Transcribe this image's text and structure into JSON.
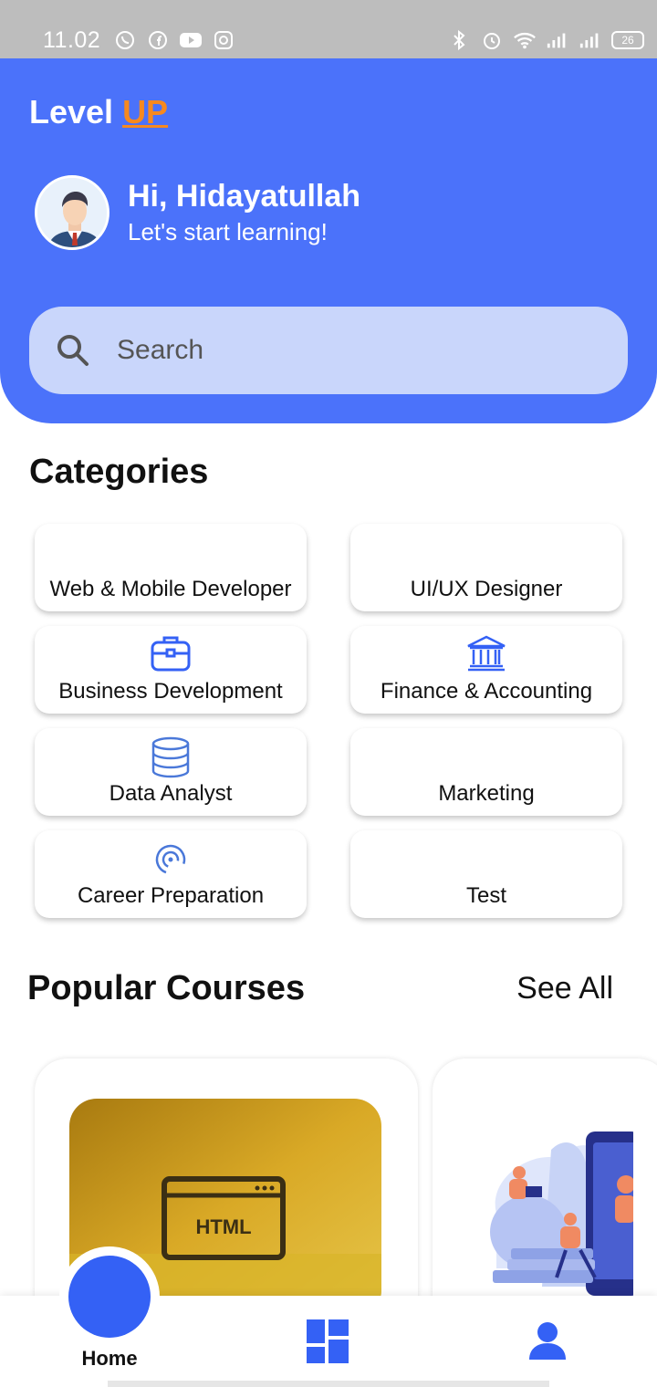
{
  "status_bar": {
    "time": "11.02",
    "battery": "26"
  },
  "app": {
    "logo_main": "Level ",
    "logo_accent": "UP"
  },
  "user": {
    "greeting": "Hi, Hidayatullah",
    "subtitle": "Let's start learning!"
  },
  "search": {
    "placeholder": "Search"
  },
  "categories": {
    "title": "Categories",
    "items": [
      {
        "label": "Web & Mobile Developer",
        "icon": "none"
      },
      {
        "label": "UI/UX Designer",
        "icon": "none"
      },
      {
        "label": "Business Development",
        "icon": "briefcase-icon"
      },
      {
        "label": "Finance & Accounting",
        "icon": "bank-icon"
      },
      {
        "label": "Data Analyst",
        "icon": "database-icon"
      },
      {
        "label": "Marketing",
        "icon": "none"
      },
      {
        "label": "Career Preparation",
        "icon": "broadcast-icon"
      },
      {
        "label": "Test",
        "icon": "none"
      }
    ]
  },
  "popular": {
    "title": "Popular Courses",
    "see_all": "See All",
    "course1_badge": "HTML"
  },
  "nav": {
    "home": "Home"
  },
  "colors": {
    "primary": "#4b72fa",
    "accent": "#f6891f",
    "nav_active": "#3461f5"
  }
}
